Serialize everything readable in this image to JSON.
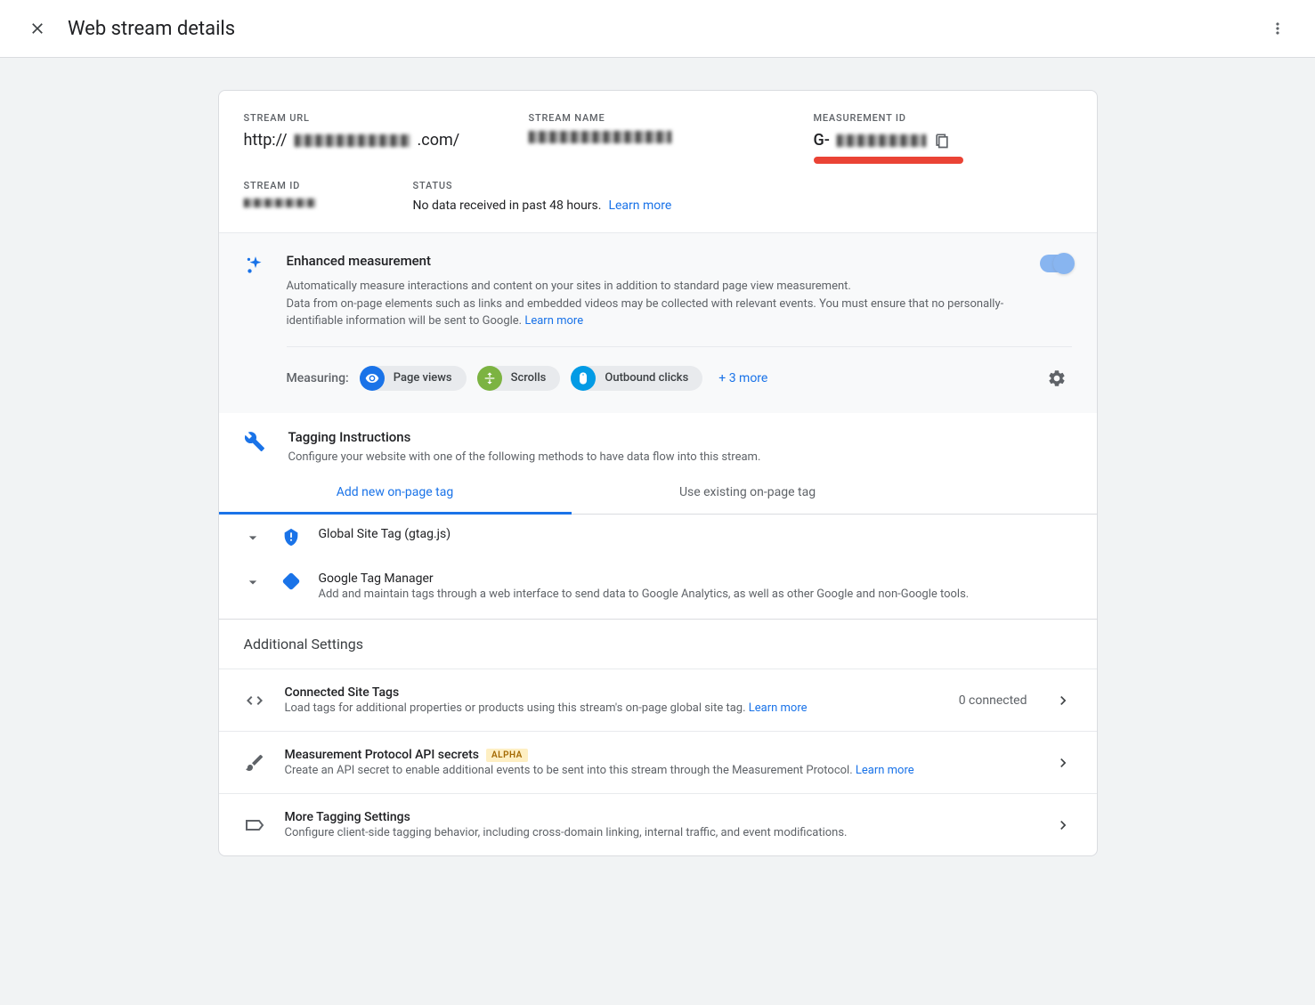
{
  "header": {
    "title": "Web stream details"
  },
  "info": {
    "stream_url_label": "STREAM URL",
    "stream_url_prefix": "http://",
    "stream_url_suffix": ".com/",
    "stream_name_label": "STREAM NAME",
    "measurement_id_label": "MEASUREMENT ID",
    "measurement_id_prefix": "G-",
    "stream_id_label": "STREAM ID",
    "status_label": "STATUS",
    "status_value": "No data received in past 48 hours. ",
    "status_link": "Learn more"
  },
  "enhanced": {
    "title": "Enhanced measurement",
    "desc1": "Automatically measure interactions and content on your sites in addition to standard page view measurement.",
    "desc2": "Data from on-page elements such as links and embedded videos may be collected with relevant events. You must ensure that no personally-identifiable information will be sent to Google. ",
    "learn_more": "Learn more",
    "measuring_label": "Measuring:",
    "pills": [
      {
        "label": "Page views"
      },
      {
        "label": "Scrolls"
      },
      {
        "label": "Outbound clicks"
      }
    ],
    "more_link": "+ 3 more"
  },
  "tagging": {
    "title": "Tagging Instructions",
    "desc": "Configure your website with one of the following methods to have data flow into this stream.",
    "tabs": [
      {
        "label": "Add new on-page tag"
      },
      {
        "label": "Use existing on-page tag"
      }
    ],
    "items": [
      {
        "title": "Global Site Tag (gtag.js)",
        "desc": ""
      },
      {
        "title": "Google Tag Manager",
        "desc": "Add and maintain tags through a web interface to send data to Google Analytics, as well as other Google and non-Google tools."
      }
    ]
  },
  "additional": {
    "header": "Additional Settings",
    "rows": [
      {
        "title": "Connected Site Tags",
        "desc": "Load tags for additional properties or products using this stream's on-page global site tag. ",
        "link": "Learn more",
        "meta": "0 connected",
        "badge": ""
      },
      {
        "title": "Measurement Protocol API secrets",
        "desc": "Create an API secret to enable additional events to be sent into this stream through the Measurement Protocol. ",
        "link": "Learn more",
        "meta": "",
        "badge": "ALPHA"
      },
      {
        "title": "More Tagging Settings",
        "desc": "Configure client-side tagging behavior, including cross-domain linking, internal traffic, and event modifications.",
        "link": "",
        "meta": "",
        "badge": ""
      }
    ]
  }
}
